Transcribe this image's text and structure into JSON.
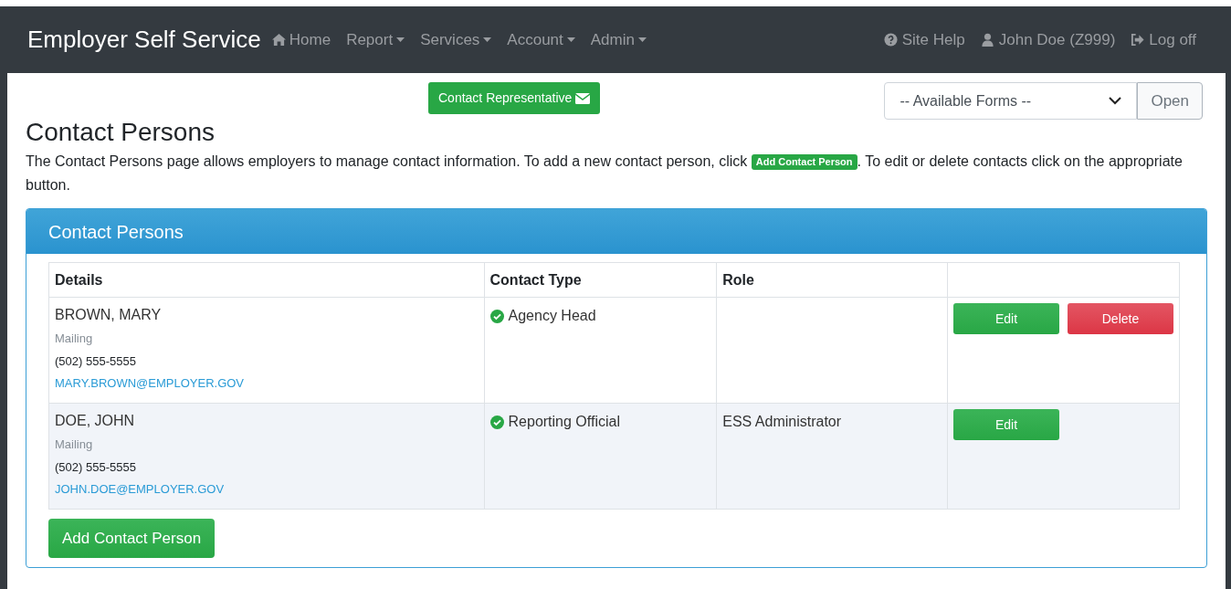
{
  "navbar": {
    "brand": "Employer Self Service",
    "menu": [
      {
        "label": "Home",
        "kind": "home",
        "dropdown": false
      },
      {
        "label": "Report",
        "kind": "plain",
        "dropdown": true
      },
      {
        "label": "Services",
        "kind": "plain",
        "dropdown": true
      },
      {
        "label": "Account",
        "kind": "plain",
        "dropdown": true
      },
      {
        "label": "Admin",
        "kind": "plain",
        "dropdown": true
      }
    ],
    "right": [
      {
        "label": "Site Help",
        "kind": "help"
      },
      {
        "label": "John Doe (Z999)",
        "kind": "user"
      },
      {
        "label": "Log off",
        "kind": "logoff"
      }
    ]
  },
  "contact_button": "Contact Representative",
  "forms": {
    "select": "-- Available Forms --",
    "open_button": "Open"
  },
  "heading": "Contact Persons",
  "description": {
    "before": "The Contact Persons page allows employers to manage contact information. To add a new contact person, click",
    "button": "Add Contact Person",
    "after": ". To edit or delete contacts click on the appropriate button."
  },
  "panel": {
    "title": "Contact Persons",
    "columns": [
      "Details",
      "Contact Type",
      "Role"
    ],
    "rows": [
      {
        "name": "BROWN, MARY",
        "address_type": "Mailing",
        "phone": "(502) 555-5555",
        "email": "MARY.BROWN@EMPLOYER.GOV",
        "contact_type": "Agency Head",
        "role": "",
        "actions": [
          {
            "label": "Edit",
            "kind": "edit"
          },
          {
            "label": "Delete",
            "kind": "delete"
          }
        ]
      },
      {
        "name": "DOE, JOHN",
        "address_type": "Mailing",
        "phone": "(502) 555-5555",
        "email": "JOHN.DOE@EMPLOYER.GOV",
        "contact_type": "Reporting Official",
        "role": "ESS Administrator",
        "actions": [
          {
            "label": "Edit",
            "kind": "edit"
          }
        ]
      }
    ],
    "add_button": "Add Contact Person"
  }
}
